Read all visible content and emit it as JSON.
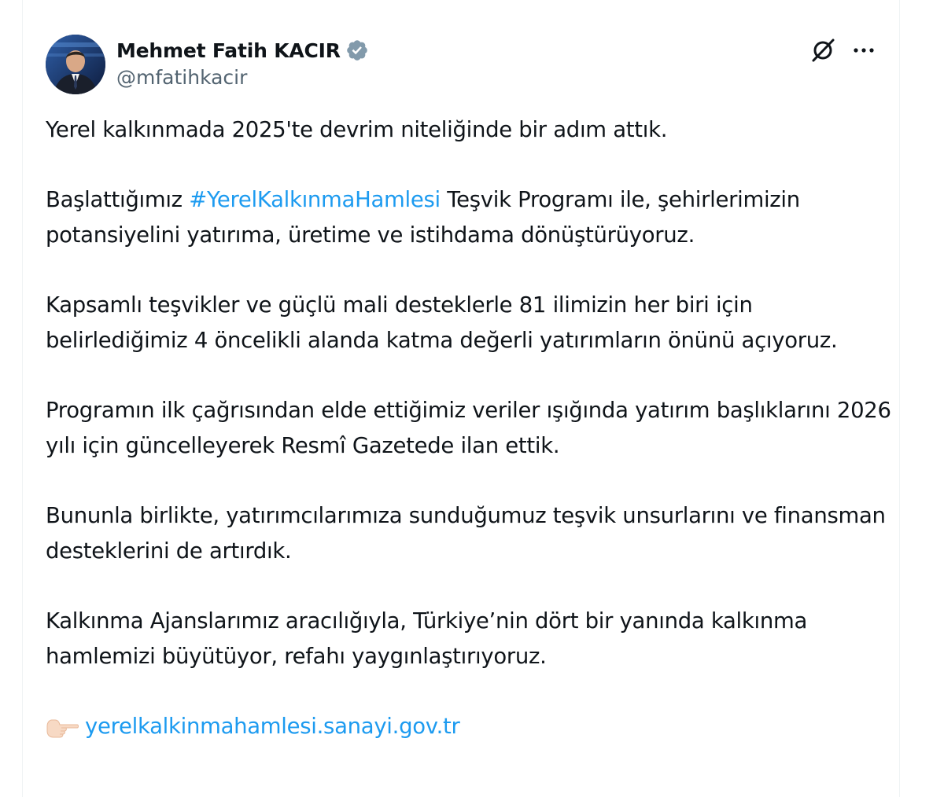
{
  "author": {
    "display_name": "Mehmet Fatih KACIR",
    "handle": "@mfatihkacir",
    "verified_icon": "verified-badge-icon",
    "verified_color": "#829aab"
  },
  "actions": {
    "grok_icon": "grok-icon",
    "more_icon": "more-options-icon"
  },
  "tweet": {
    "p1": "Yerel kalkınmada 2025'te devrim niteliğinde bir adım attık.",
    "p2_before": "Başlattığımız ",
    "p2_hashtag": "#YerelKalkınmaHamlesi",
    "p2_after": " Teşvik Programı ile, şehirlerimizin potansiyelini yatırıma, üretime ve istihdama dönüştürüyoruz.",
    "p3": "Kapsamlı teşvikler ve güçlü mali desteklerle 81 ilimizin her biri için belirlediğimiz 4 öncelikli alanda katma değerli yatırımların önünü açıyoruz.",
    "p4": "Programın ilk çağrısından elde ettiğimiz veriler ışığında yatırım başlıklarını 2026 yılı için güncelleyerek Resmî Gazetede ilan ettik.",
    "p5": "Bununla birlikte, yatırımcılarımıza sunduğumuz teşvik unsurlarını ve finansman desteklerini de artırdık.",
    "p6": "Kalkınma Ajanslarımız aracılığıyla, Türkiye’nin dört bir yanında kalkınma hamlemizi büyütüyor, refahı yaygınlaştırıyoruz.",
    "link_emoji_icon": "pointing-hand-icon",
    "link": "yerelkalkinmahamlesi.sanayi.gov.tr"
  },
  "colors": {
    "text": "#0f1419",
    "secondary": "#536471",
    "accent": "#1d9bf0"
  }
}
